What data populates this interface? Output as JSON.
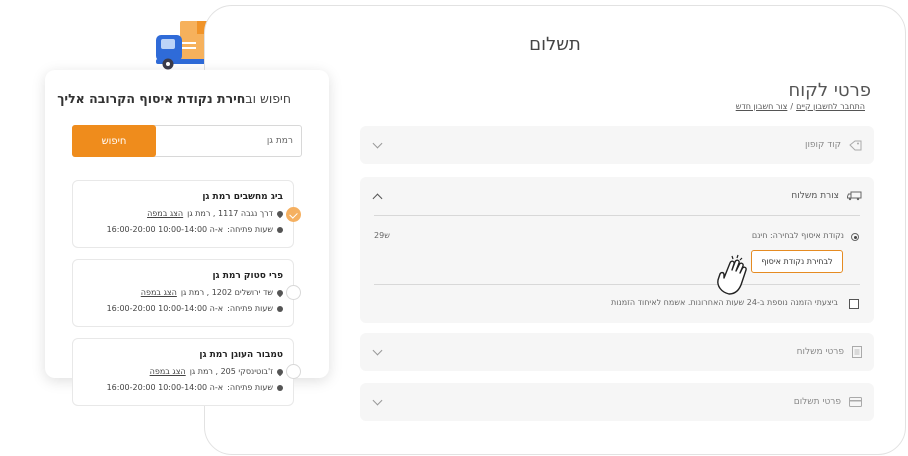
{
  "page": {
    "title": "תשלום"
  },
  "customer": {
    "title": "פרטי לקוח",
    "login_existing": "התחבר לחשבון קיים",
    "separator": "/",
    "create_account": "צור חשבון חדש"
  },
  "sections": {
    "coupon": {
      "label": "קוד קופון",
      "icon": "tag-icon"
    },
    "shipping": {
      "label": "צורת משלוח",
      "icon": "truck-icon",
      "option_label": "נקודת איסוף לבחירה: חינם",
      "option_price": "29ש",
      "pickup_button": "לבחירת נקודת איסוף",
      "check_label": "ביצעתי הזמנה נוספת ב-24 שעות האחרונות. אשמח לאיחוד הזמנות"
    },
    "delivery": {
      "label": "פרטי משלוח",
      "icon": "document-icon"
    },
    "payment": {
      "label": "פרטי תשלום",
      "icon": "credit-card-icon"
    }
  },
  "pickup_panel": {
    "title_plain": "חיפוש וב",
    "title_bold": "חירת נקודת איסוף הקרובה אליך",
    "search_value": "רמת גן",
    "search_button": "חיפוש",
    "stores": [
      {
        "name": "ביג מחשבים רמת גן",
        "address": "דרך נגבה 1117 , רמת גן",
        "map_link": "הצג במפה",
        "hours_label": "שעות פתיחה:",
        "hours": "א-ה 10:00-14:00 16:00-20:00",
        "selected": true
      },
      {
        "name": "פרי סטוק רמת גן",
        "address": "שד ירושלים 1202 , רמת גן",
        "map_link": "הצג במפה",
        "hours_label": "שעות פתיחה:",
        "hours": "א-ה 10:00-14:00 16:00-20:00",
        "selected": false
      },
      {
        "name": "טמבור העוגן רמת גן",
        "address": "ז'בוטינסקי 205 , רמת גן",
        "map_link": "הצג במפה",
        "hours_label": "שעות פתיחה:",
        "hours": "א-ה 10:00-14:00 16:00-20:00",
        "selected": false
      }
    ]
  },
  "colors": {
    "accent": "#ef8c1c",
    "selected_radio": "#f5b061",
    "truck_blue": "#2f6bd8",
    "box": "#f6b15c"
  }
}
